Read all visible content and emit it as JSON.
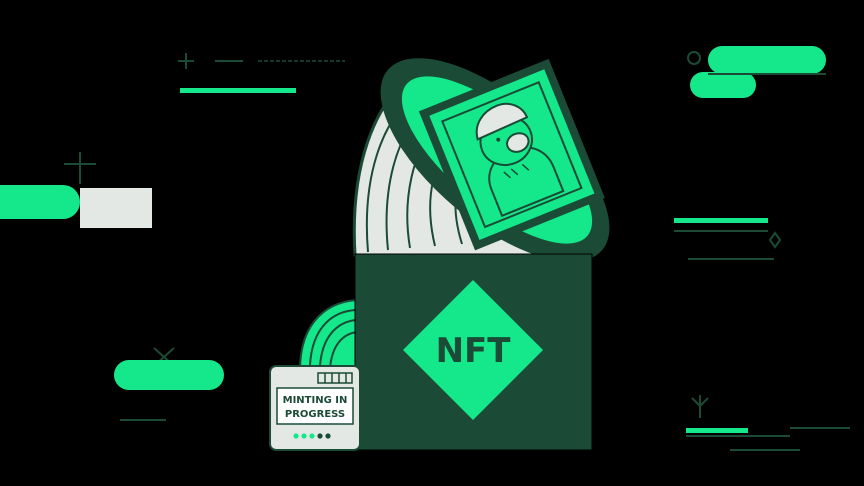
{
  "illustration": {
    "box_label": "NFT",
    "status_card": {
      "line1": "MINTING IN",
      "line2": "PROGRESS"
    },
    "colors": {
      "background": "#000000",
      "dark_green": "#1b4a36",
      "accent_green": "#14e88a",
      "light_gray": "#e3e8e4",
      "white": "#ffffff"
    }
  }
}
